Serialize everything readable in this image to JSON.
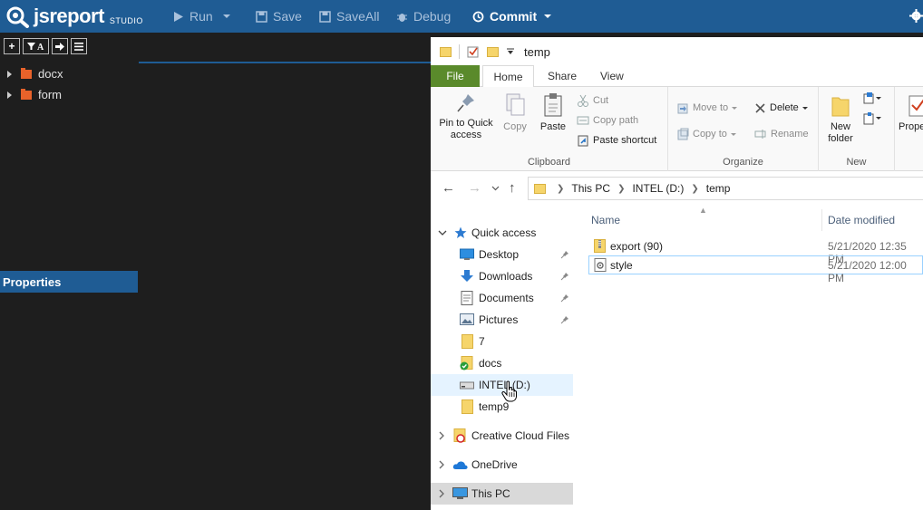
{
  "app": {
    "logo_text": "jsreport",
    "logo_sub": "STUDIO",
    "toolbar": {
      "run": "Run",
      "save": "Save",
      "save_all": "SaveAll",
      "debug": "Debug",
      "commit": "Commit"
    },
    "tree": [
      {
        "label": "docx"
      },
      {
        "label": "form"
      }
    ],
    "properties_label": "Properties"
  },
  "explorer": {
    "title": "temp",
    "tabs": {
      "file": "File",
      "home": "Home",
      "share": "Share",
      "view": "View"
    },
    "ribbon": {
      "clipboard": {
        "label": "Clipboard",
        "pin": "Pin to Quick access",
        "copy": "Copy",
        "paste": "Paste",
        "cut": "Cut",
        "copy_path": "Copy path",
        "paste_shortcut": "Paste shortcut"
      },
      "organize": {
        "label": "Organize",
        "move_to": "Move to",
        "copy_to": "Copy to",
        "delete": "Delete",
        "rename": "Rename"
      },
      "new": {
        "label": "New",
        "new_folder": "New folder"
      },
      "open": {
        "properties": "Prope"
      }
    },
    "breadcrumb": [
      "This PC",
      "INTEL (D:)",
      "temp"
    ],
    "nav": {
      "quick_access": "Quick access",
      "items": [
        {
          "label": "Desktop",
          "pinned": true
        },
        {
          "label": "Downloads",
          "pinned": true
        },
        {
          "label": "Documents",
          "pinned": true
        },
        {
          "label": "Pictures",
          "pinned": true
        },
        {
          "label": "7",
          "pinned": false
        },
        {
          "label": "docs",
          "pinned": false
        },
        {
          "label": "INTEL (D:)",
          "pinned": false
        },
        {
          "label": "temp9",
          "pinned": false
        }
      ],
      "creative_cloud": "Creative Cloud Files",
      "onedrive": "OneDrive",
      "this_pc": "This PC"
    },
    "columns": {
      "name": "Name",
      "date": "Date modified"
    },
    "files": [
      {
        "name": "export (90)",
        "date": "5/21/2020 12:35 PM"
      },
      {
        "name": "style",
        "date": "5/21/2020 12:00 PM"
      }
    ]
  }
}
